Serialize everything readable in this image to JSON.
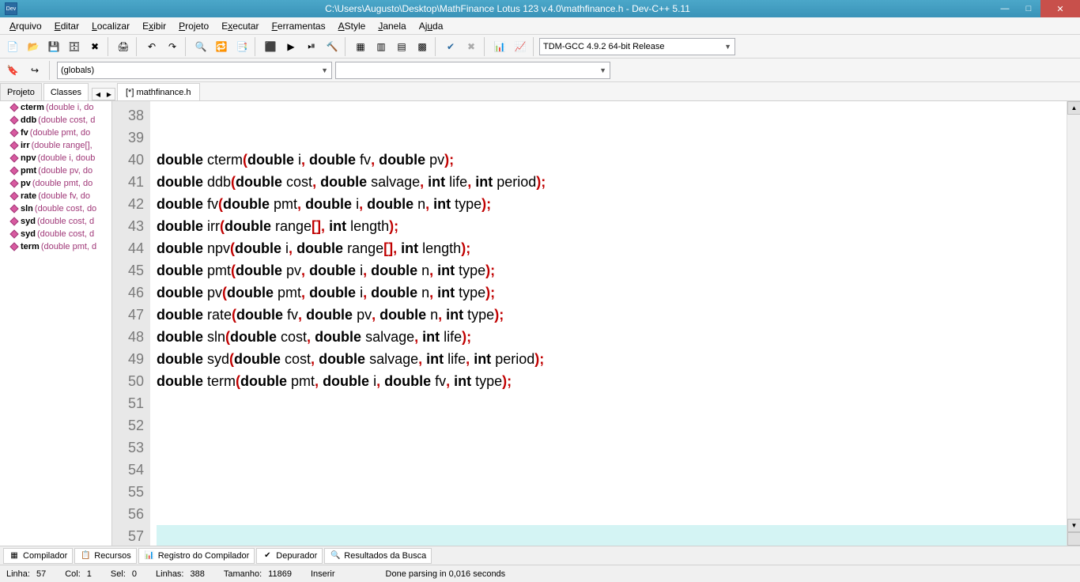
{
  "title": "C:\\Users\\Augusto\\Desktop\\MathFinance Lotus 123 v.4.0\\mathfinance.h - Dev-C++ 5.11",
  "menu": [
    "Arquivo",
    "Editar",
    "Localizar",
    "Exibir",
    "Projeto",
    "Executar",
    "Ferramentas",
    "AStyle",
    "Janela",
    "Ajuda"
  ],
  "menu_underline": [
    0,
    0,
    0,
    1,
    0,
    1,
    0,
    0,
    0,
    2
  ],
  "compiler_combo": "TDM-GCC 4.9.2 64-bit Release",
  "globals_combo": "(globals)",
  "side_tabs": {
    "active": "Classes",
    "other": "Projeto"
  },
  "file_tab": "[*] mathfinance.h",
  "functions": [
    {
      "name": "cterm",
      "sig": "(double i, do"
    },
    {
      "name": "ddb",
      "sig": "(double cost, d"
    },
    {
      "name": "fv",
      "sig": "(double pmt, do"
    },
    {
      "name": "irr",
      "sig": "(double range[],"
    },
    {
      "name": "npv",
      "sig": "(double i, doub"
    },
    {
      "name": "pmt",
      "sig": "(double pv, do"
    },
    {
      "name": "pv",
      "sig": "(double pmt, do"
    },
    {
      "name": "rate",
      "sig": "(double fv, do"
    },
    {
      "name": "sln",
      "sig": "(double cost, do"
    },
    {
      "name": "syd",
      "sig": "(double cost, d"
    },
    {
      "name": "syd",
      "sig": "(double cost, d"
    },
    {
      "name": "term",
      "sig": "(double pmt, d"
    }
  ],
  "code_start_line": 38,
  "code_lines": [
    "",
    "",
    [
      "double",
      " cterm",
      "(",
      "double",
      " i",
      ", ",
      "double",
      " fv",
      ", ",
      "double",
      " pv",
      ");"
    ],
    [
      "double",
      " ddb",
      "(",
      "double",
      " cost",
      ", ",
      "double",
      " salvage",
      ", ",
      "int",
      " life",
      ", ",
      "int",
      " period",
      ");"
    ],
    [
      "double",
      " fv",
      "(",
      "double",
      " pmt",
      ", ",
      "double",
      " i",
      ", ",
      "double",
      " n",
      ", ",
      "int",
      " type",
      ");"
    ],
    [
      "double",
      " irr",
      "(",
      "double",
      " range",
      "[], ",
      "int",
      " length",
      ");"
    ],
    [
      "double",
      " npv",
      "(",
      "double",
      " i",
      ", ",
      "double",
      " range",
      "[], ",
      "int",
      " length",
      ");"
    ],
    [
      "double",
      " pmt",
      "(",
      "double",
      " pv",
      ", ",
      "double",
      " i",
      ", ",
      "double",
      " n",
      ", ",
      "int",
      " type",
      ");"
    ],
    [
      "double",
      " pv",
      "(",
      "double",
      " pmt",
      ", ",
      "double",
      " i",
      ", ",
      "double",
      " n",
      ", ",
      "int",
      " type",
      ");"
    ],
    [
      "double",
      " rate",
      "(",
      "double",
      " fv",
      ", ",
      "double",
      " pv",
      ", ",
      "double",
      " n",
      ", ",
      "int",
      " type",
      ");"
    ],
    [
      "double",
      " sln",
      "(",
      "double",
      " cost",
      ", ",
      "double",
      " salvage",
      ", ",
      "int",
      " life",
      ");"
    ],
    [
      "double",
      " syd",
      "(",
      "double",
      " cost",
      ", ",
      "double",
      " salvage",
      ", ",
      "int",
      " life",
      ", ",
      "int",
      " period",
      ");"
    ],
    [
      "double",
      " term",
      "(",
      "double",
      " pmt",
      ", ",
      "double",
      " i",
      ", ",
      "double",
      " fv",
      ", ",
      "int",
      " type",
      ");"
    ],
    "",
    "",
    "",
    "",
    "",
    "",
    ""
  ],
  "bottom_tabs": [
    "Compilador",
    "Recursos",
    "Registro do Compilador",
    "Depurador",
    "Resultados da Busca"
  ],
  "status": {
    "linha_label": "Linha:",
    "linha": "57",
    "col_label": "Col:",
    "col": "1",
    "sel_label": "Sel:",
    "sel": "0",
    "linhas_label": "Linhas:",
    "linhas": "388",
    "tamanho_label": "Tamanho:",
    "tamanho": "11869",
    "mode": "Inserir",
    "parse": "Done parsing in 0,016 seconds"
  }
}
